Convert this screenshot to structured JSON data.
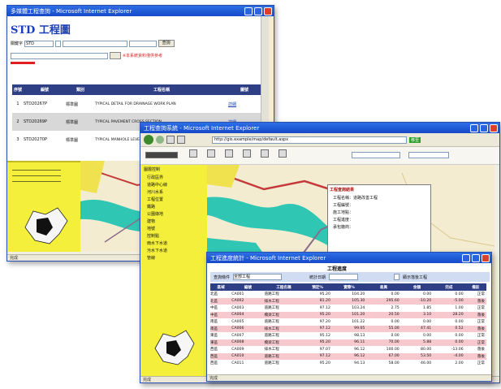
{
  "win1": {
    "title": "多媒體工程查詢 - Microsoft Internet Explorer",
    "page_title": "STD 工程圖",
    "search_label": "關鍵字",
    "search_value": "STD",
    "button_query": "查詢",
    "notice": "※本系統資料僅供參考",
    "table_headers": [
      "序號",
      "編號",
      "類別",
      "工程名稱",
      "圖號"
    ],
    "rows": [
      {
        "no": "1",
        "code": "STD20267P",
        "type": "標準圖",
        "name": "TYPICAL DETAIL FOR DRAINAGE WORK PLAN",
        "link": "詳細"
      },
      {
        "no": "2",
        "code": "STD20269P",
        "type": "標準圖",
        "name": "TYPICAL PAVEMENT CROSS SECTION",
        "link": "詳細"
      },
      {
        "no": "3",
        "code": "STD20270P",
        "type": "標準圖",
        "name": "TYPICAL MANHOLE LEVEL PLAN",
        "link": "詳細"
      }
    ],
    "status": "完成"
  },
  "win2": {
    "title": "工程查詢系統 - Microsoft Internet Explorer",
    "address": "http://gis.example/map/default.aspx",
    "go_label": "移至",
    "toolbar": [
      "平移",
      "放大",
      "縮小",
      "全圖",
      "查詢",
      "列印"
    ],
    "legend_title": "圖層控制",
    "layers": [
      "行政區界",
      "道路中心線",
      "河川水系",
      "工程位置",
      "鐵路",
      "公園綠地",
      "建物",
      "地號",
      "控制點",
      "雨水下水道",
      "污水下水道",
      "管線"
    ],
    "info_title": "工程查詢結果",
    "info_items": [
      "工程名稱：道路改善工程",
      "工程編號：",
      "施工地點：",
      "工程進度：",
      "承包廠商："
    ],
    "status": "完成"
  },
  "win3": {
    "title": "工程進度統計 - Microsoft Internet Explorer",
    "section_title": "工程進度",
    "filter_label": "查詢條件",
    "filter_value": "全部工程",
    "date_label": "統計日期",
    "checkbox_label": "顯示落後工程",
    "headers": [
      "區域",
      "編號",
      "工程名稱",
      "預定%",
      "實際%",
      "差異",
      "金額",
      "完成",
      "備註"
    ],
    "rows": [
      [
        "北區",
        "CA001",
        "道路工程",
        "95.20",
        "104.20",
        "0.00",
        "0.00",
        "0.00",
        "正常"
      ],
      [
        "北區",
        "CA002",
        "排水工程",
        "81.20",
        "105.30",
        "295.60",
        "-10.20",
        "-5.00",
        "落後"
      ],
      [
        "中區",
        "CA003",
        "道路工程",
        "97.12",
        "103.24",
        "2.75",
        "1.85",
        "1.00",
        "正常"
      ],
      [
        "中區",
        "CA004",
        "橋梁工程",
        "95.20",
        "101.20",
        "20.50",
        "3.10",
        "28.20",
        "落後"
      ],
      [
        "南區",
        "CA005",
        "道路工程",
        "97.20",
        "101.22",
        "0.00",
        "0.00",
        "0.00",
        "正常"
      ],
      [
        "南區",
        "CA006",
        "排水工程",
        "97.12",
        "99.05",
        "55.00",
        "47.41",
        "0.52",
        "落後"
      ],
      [
        "東區",
        "CA007",
        "道路工程",
        "95.12",
        "98.13",
        "0.00",
        "0.00",
        "0.00",
        "正常"
      ],
      [
        "東區",
        "CA008",
        "橋梁工程",
        "95.20",
        "96.11",
        "70.00",
        "5.88",
        "0.00",
        "正常"
      ],
      [
        "西區",
        "CA009",
        "排水工程",
        "97.07",
        "96.12",
        "100.00",
        "80.00",
        "-13.06",
        "落後"
      ],
      [
        "西區",
        "CA010",
        "道路工程",
        "97.12",
        "96.12",
        "67.00",
        "53.50",
        "-4.00",
        "落後"
      ],
      [
        "西區",
        "CA011",
        "道路工程",
        "95.20",
        "94.13",
        "58.00",
        "46.00",
        "2.00",
        "正常"
      ]
    ],
    "status": "完成"
  },
  "colors": {
    "title_blue": "#1a55d6",
    "accent_red": "#d9412a",
    "row_pink": "#f7c9cf",
    "header_blue": "#2f3f86",
    "map_green": "#2fc7b4"
  }
}
